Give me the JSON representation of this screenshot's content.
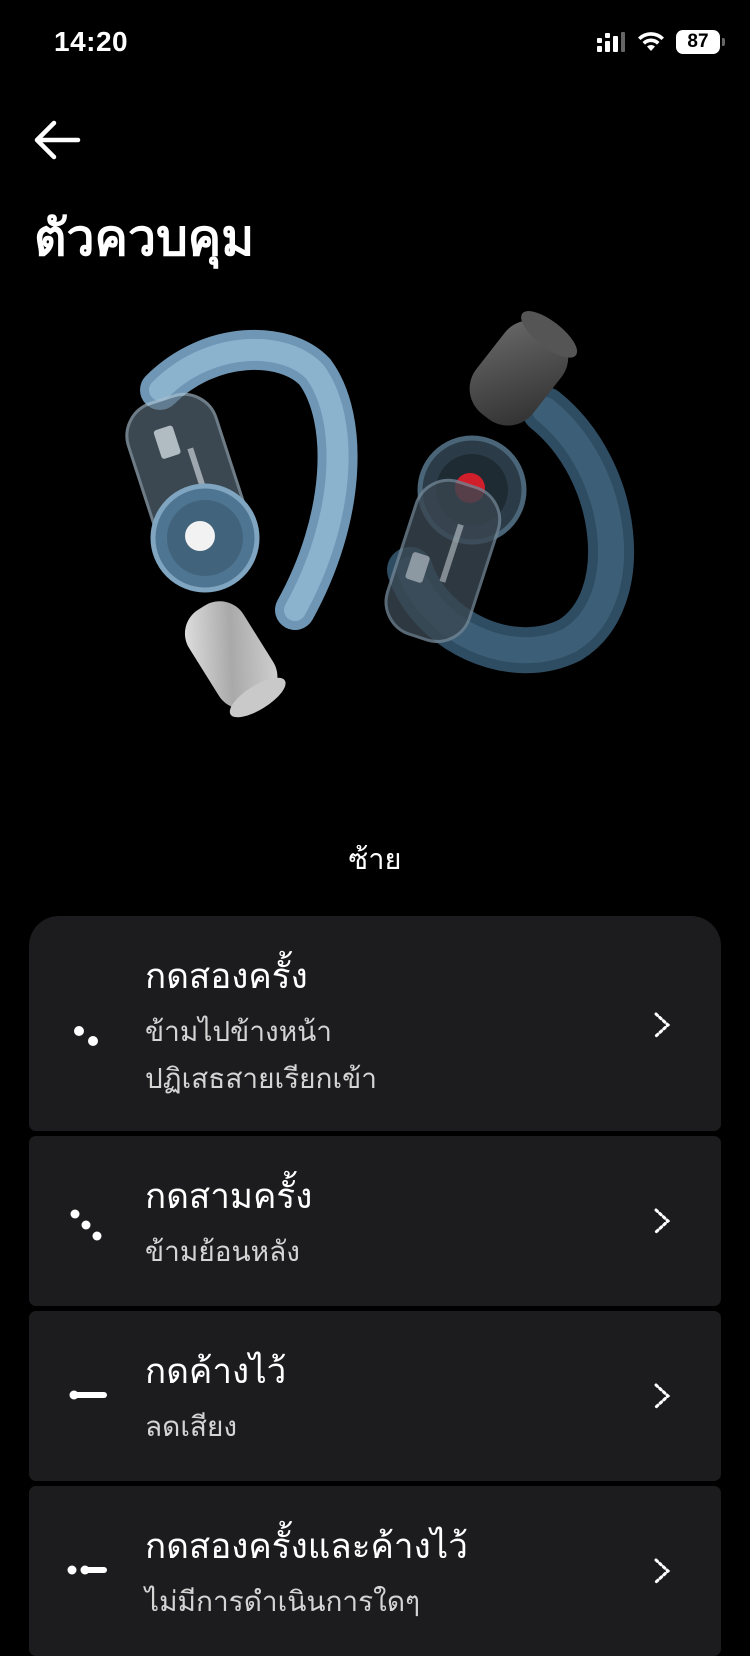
{
  "status_bar": {
    "time": "14:20",
    "battery": "87",
    "icons": [
      "cellular-signal-icon",
      "wifi-icon",
      "battery-icon"
    ]
  },
  "nav": {
    "back_icon": "arrow-left-icon"
  },
  "page": {
    "title": "ตัวควบคุม",
    "side_label": "ซ้าย"
  },
  "controls": [
    {
      "title": "กดสองครั้ง",
      "lines": [
        "ข้ามไปข้างหน้า",
        "ปฏิเสธสายเรียกเข้า"
      ],
      "icon": "double-tap-icon"
    },
    {
      "title": "กดสามครั้ง",
      "lines": [
        "ข้ามย้อนหลัง"
      ],
      "icon": "triple-tap-icon"
    },
    {
      "title": "กดค้างไว้",
      "lines": [
        "ลดเสียง"
      ],
      "icon": "press-hold-icon"
    },
    {
      "title": "กดสองครั้งและค้างไว้",
      "lines": [
        "ไม่มีการดำเนินการใดๆ"
      ],
      "icon": "double-tap-hold-icon"
    }
  ],
  "colors": {
    "background": "#000000",
    "card": "#1c1c1e",
    "text": "#ffffff",
    "subtext": "#d4d4d4",
    "earbud_left": "#7ea5c2",
    "earbud_right": "#36556b"
  }
}
